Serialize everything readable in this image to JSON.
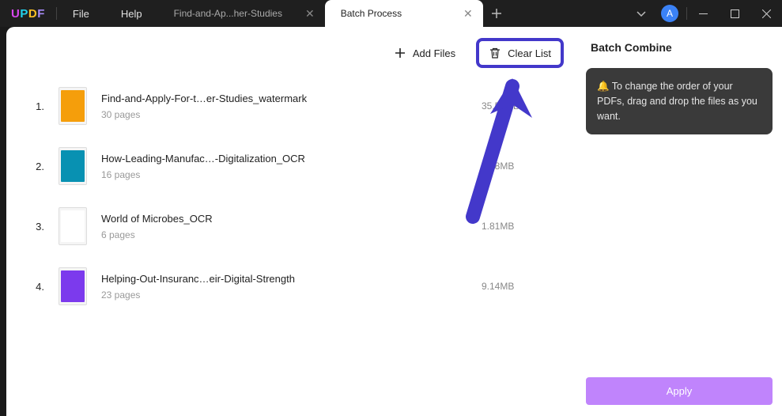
{
  "logo": {
    "u": "U",
    "p": "P",
    "d": "D",
    "f": "F"
  },
  "menu": {
    "file": "File",
    "help": "Help"
  },
  "tabs": {
    "inactive": {
      "label": "Find-and-Ap...her-Studies"
    },
    "active": {
      "label": "Batch Process"
    }
  },
  "avatar": {
    "initial": "A"
  },
  "toolbar": {
    "add_files": "Add Files",
    "clear_list": "Clear List"
  },
  "files": [
    {
      "num": "1.",
      "name": "Find-and-Apply-For-t…er-Studies_watermark",
      "pages": "30 pages",
      "size": "35.50MB",
      "thumb_bg": "#f59e0b"
    },
    {
      "num": "2.",
      "name": "How-Leading-Manufac…-Digitalization_OCR",
      "pages": "16 pages",
      "size": "1.18MB",
      "thumb_bg": "#0891b2"
    },
    {
      "num": "3.",
      "name": "World of Microbes_OCR",
      "pages": "6 pages",
      "size": "1.81MB",
      "thumb_bg": "#ffffff"
    },
    {
      "num": "4.",
      "name": "Helping-Out-Insuranc…eir-Digital-Strength",
      "pages": "23 pages",
      "size": "9.14MB",
      "thumb_bg": "#7c3aed"
    }
  ],
  "sidebar": {
    "title": "Batch Combine",
    "tip": "🔔 To change the order of your PDFs, drag and drop the files as you want.",
    "apply": "Apply"
  }
}
